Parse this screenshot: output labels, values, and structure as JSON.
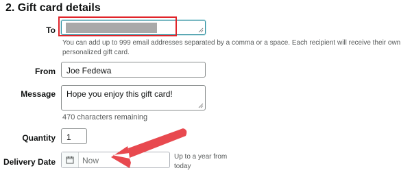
{
  "section": {
    "title": "2. Gift card details"
  },
  "to": {
    "label": "To",
    "helper": "You can add up to 999 email addresses separated by a comma or a space. Each recipient will receive their own personalized gift card."
  },
  "from": {
    "label": "From",
    "value": "Joe Fedewa"
  },
  "message": {
    "label": "Message",
    "value": "Hope you enjoy this gift card!",
    "remaining": "470 characters remaining"
  },
  "quantity": {
    "label": "Quantity",
    "value": "1"
  },
  "delivery": {
    "label": "Delivery Date",
    "placeholder": "Now",
    "hint": "Up to a year from today",
    "icon": "calendar-icon"
  },
  "colors": {
    "highlight_box": "#e0242a",
    "annotation_arrow": "#e8494f",
    "redaction": "#a9a9a9",
    "focus_border": "#2c8e9e"
  }
}
